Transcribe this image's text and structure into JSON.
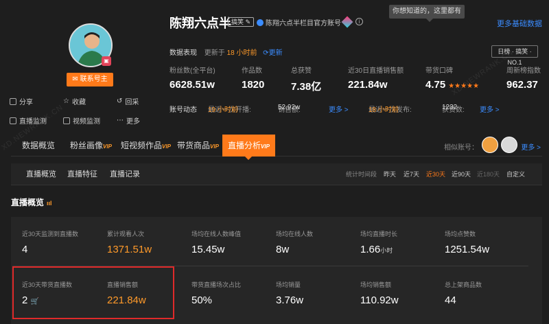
{
  "tooltip": "你想知道的，这里都有",
  "more_basic": "更多基础数据",
  "profile": {
    "name": "陈翔六点半",
    "tag": "搞笑",
    "verified": "陈翔六点半栏目官方账号",
    "contact": "联系号主",
    "actions": [
      "分享",
      "收藏",
      "回采",
      "直播监测",
      "视频监测",
      "更多"
    ]
  },
  "data_perf": {
    "label": "数据表现",
    "updated_prefix": "更新于",
    "updated_time": "18 小时前",
    "refresh": "更新",
    "rank": "日榜 · 搞笑 · NO.1"
  },
  "stats": [
    {
      "label": "粉丝数(全平台)",
      "value": "6628.51w"
    },
    {
      "label": "作品数",
      "value": "1820"
    },
    {
      "label": "总获赞",
      "value": "7.38亿"
    },
    {
      "label": "近30日直播销售额",
      "value": "221.84w"
    },
    {
      "label": "带货口碑",
      "value": "4.75",
      "stars": "★★★★★"
    },
    {
      "label": "周新榜指数",
      "value": "962.37"
    }
  ],
  "dynamics": {
    "label": "账号动态",
    "last_live_prefix": "最近一次开播:",
    "last_live_time": "19 小时前",
    "sales_label": "销售额:",
    "sales_value": "52.92w",
    "more1": "更多 >",
    "last_post_prefix": "最近一次发布:",
    "last_post_time": "18 小时前",
    "likes_label": "获赞数:",
    "likes_value": "1232",
    "more2": "更多 >"
  },
  "tabs": [
    {
      "label": "数据概览",
      "vip": ""
    },
    {
      "label": "粉丝画像",
      "vip": "VIP"
    },
    {
      "label": "短视频作品",
      "vip": "VIP"
    },
    {
      "label": "带货商品",
      "vip": "VIP"
    },
    {
      "label": "直播分析",
      "vip": "VIP"
    }
  ],
  "similar_label": "相似账号：",
  "tab_more": "更多 >",
  "subnav": {
    "tabs": [
      "直播概览",
      "直播特征",
      "直播记录"
    ],
    "time_label": "统计时间段",
    "time_options": [
      "昨天",
      "近7天",
      "近30天",
      "近90天",
      "近180天",
      "自定义"
    ]
  },
  "section_title": "直播概览",
  "overview_row1": [
    {
      "label": "近30天监测到直播数",
      "value": "4"
    },
    {
      "label": "累计观看人次",
      "value": "1371.51w"
    },
    {
      "label": "场均在线人数峰值",
      "value": "15.45w"
    },
    {
      "label": "场均在线人数",
      "value": "8w"
    },
    {
      "label": "场均直播时长",
      "value": "1.66",
      "unit": "小时"
    },
    {
      "label": "场均点赞数",
      "value": "1251.54w"
    }
  ],
  "overview_row2": [
    {
      "label": "近30天带货直播数",
      "value": "2"
    },
    {
      "label": "直播销售额",
      "value": "221.84w"
    },
    {
      "label": "带货直播场次占比",
      "value": "50%"
    },
    {
      "label": "场均销量",
      "value": "3.76w"
    },
    {
      "label": "场均销售额",
      "value": "110.92w"
    },
    {
      "label": "总上架商品数",
      "value": "44"
    }
  ],
  "watermark": "XD.NEWRANK.CN",
  "colors": {
    "accent": "#ff7a1a",
    "link": "#3b8cff",
    "highlight_box": "#e02a2a"
  }
}
